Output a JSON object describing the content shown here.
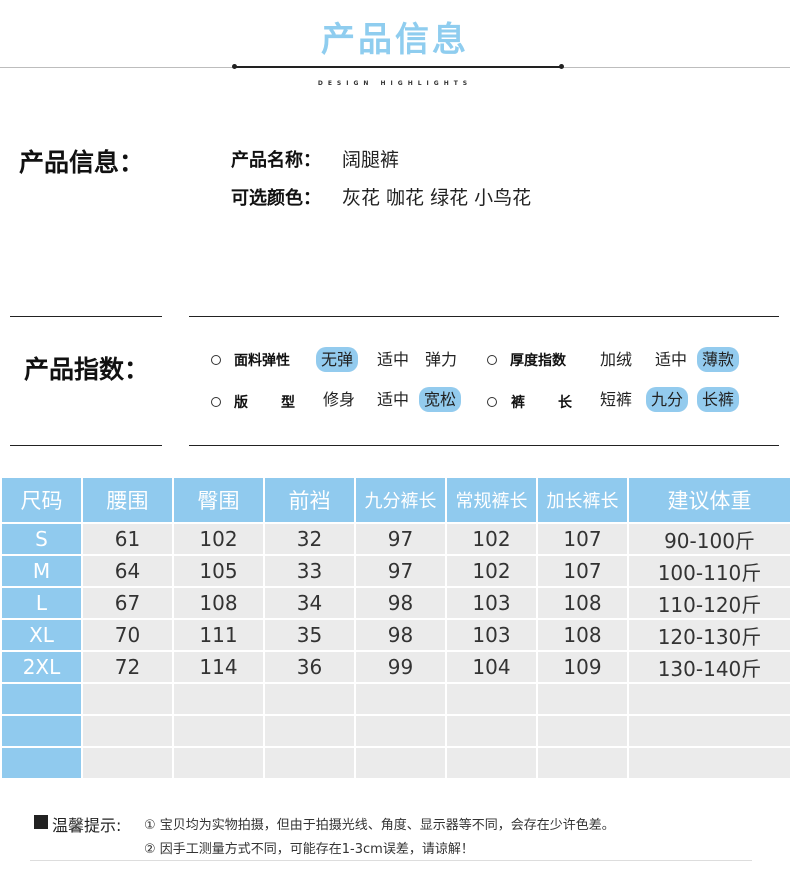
{
  "header": {
    "title": "产品信息",
    "subtitle": "DESIGN HIGHLIGHTS"
  },
  "info": {
    "label": "产品信息：",
    "name_key": "产品名称：",
    "name_value": "阔腿裤",
    "color_key": "可选颜色：",
    "color_value": "灰花 咖花 绿花 小鸟花"
  },
  "indices": {
    "label": "产品指数：",
    "elasticity": {
      "key": "面料弹性",
      "options": [
        "无弹",
        "适中",
        "弹力"
      ],
      "selected": "无弹"
    },
    "thickness": {
      "key": "厚度指数",
      "options": [
        "加绒",
        "适中",
        "薄款"
      ],
      "selected": "薄款"
    },
    "fit": {
      "key_a": "版",
      "key_b": "型",
      "options": [
        "修身",
        "适中",
        "宽松"
      ],
      "selected": "宽松"
    },
    "length": {
      "key_a": "裤",
      "key_b": "长",
      "options": [
        "短裤",
        "九分",
        "长裤"
      ],
      "selected": [
        "九分",
        "长裤"
      ]
    }
  },
  "size_table": {
    "headers": [
      "尺码",
      "腰围",
      "臀围",
      "前裆",
      "九分裤长",
      "常规裤长",
      "加长裤长",
      "建议体重"
    ],
    "rows": [
      [
        "S",
        "61",
        "102",
        "32",
        "97",
        "102",
        "107",
        "90-100斤"
      ],
      [
        "M",
        "64",
        "105",
        "33",
        "97",
        "102",
        "107",
        "100-110斤"
      ],
      [
        "L",
        "67",
        "108",
        "34",
        "98",
        "103",
        "108",
        "110-120斤"
      ],
      [
        "XL",
        "70",
        "111",
        "35",
        "98",
        "103",
        "108",
        "120-130斤"
      ],
      [
        "2XL",
        "72",
        "114",
        "36",
        "99",
        "104",
        "109",
        "130-140斤"
      ],
      [
        "",
        "",
        "",
        "",
        "",
        "",
        "",
        ""
      ],
      [
        "",
        "",
        "",
        "",
        "",
        "",
        "",
        ""
      ],
      [
        "",
        "",
        "",
        "",
        "",
        "",
        "",
        ""
      ]
    ]
  },
  "notes": {
    "title": "温馨提示:",
    "line1": "① 宝贝均为实物拍摄，但由于拍摄光线、角度、显示器等不同，会存在少许色差。",
    "line2": "② 因手工测量方式不同，可能存在1-3cm误差，请谅解！"
  },
  "colors": {
    "accent": "#90caee",
    "title": "#8fcdef",
    "cell_bg": "#ebebeb"
  }
}
